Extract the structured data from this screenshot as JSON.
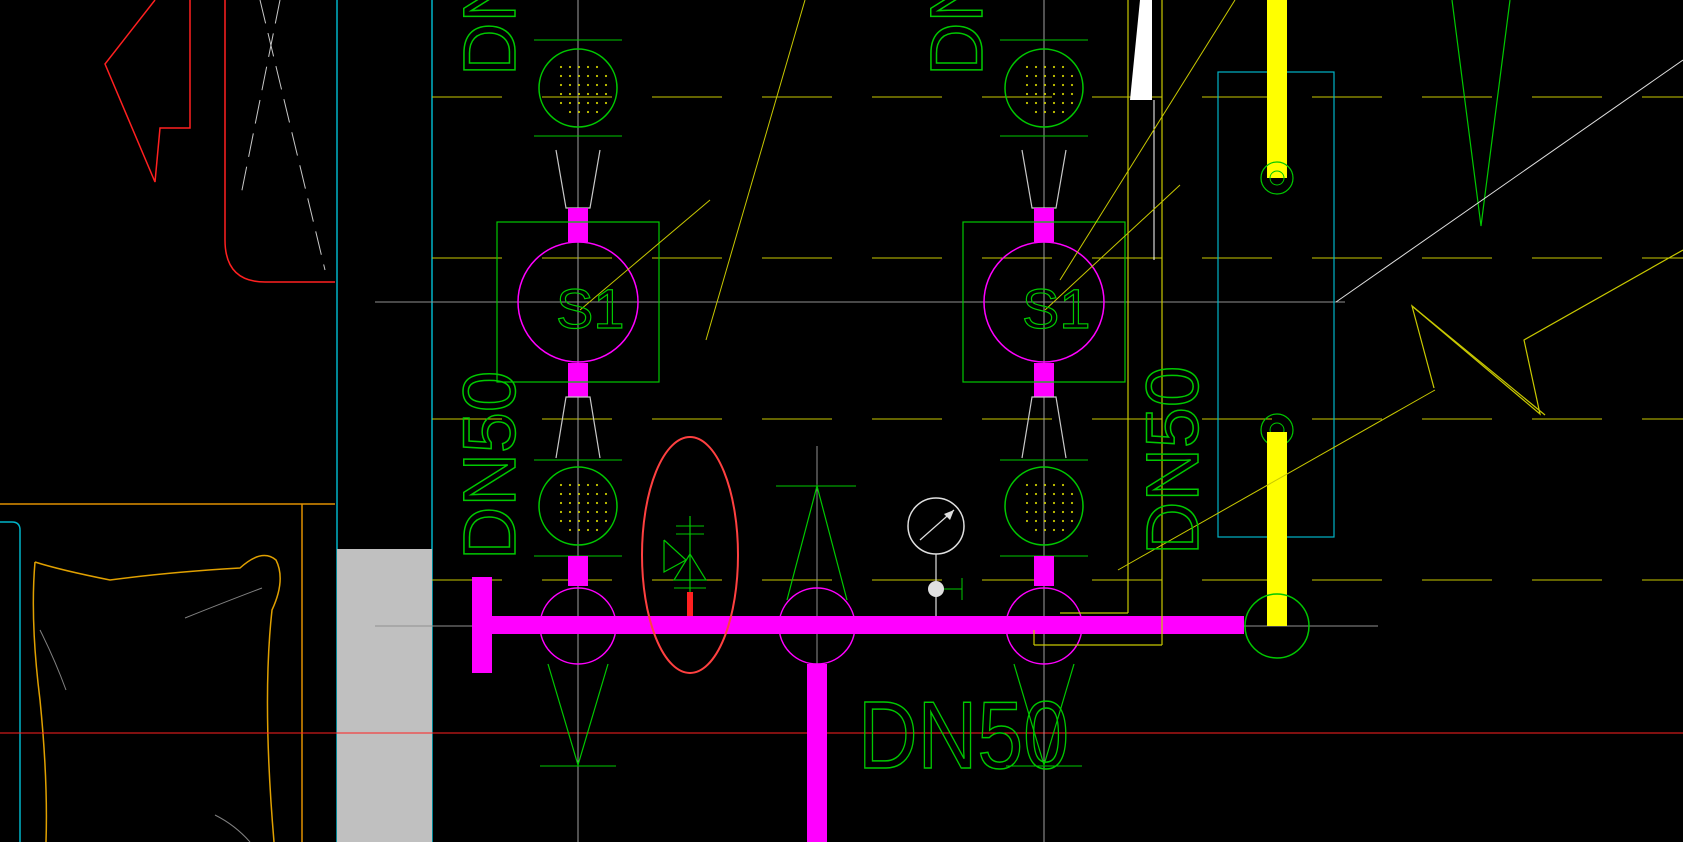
{
  "drawing": {
    "background": "#000000",
    "labels": {
      "pipe_size_bottom": "DN50",
      "pipe_size_left_vertical": "DN50",
      "pipe_size_right_vertical": "DN50",
      "pipe_size_top_left": "DN",
      "pipe_size_top_right": "DN",
      "pump_left_mark": "S1",
      "pump_right_mark": "S1"
    },
    "colors": {
      "main_pipe": "#ff00ff",
      "green_lines": "#00c800",
      "yellow_lines": "#c8c800",
      "cyan_lines": "#00b4c8",
      "red_lines": "#ff2020",
      "highlight_ellipse": "#ff4040",
      "bright_yellow_pipe": "#ffff00",
      "gray_block": "#c0c0c0",
      "orange_lines": "#e09000"
    },
    "icons": {
      "pump_symbol": "centrifugal-pump-icon",
      "check_valve": "check-valve-icon",
      "pressure_gauge": "pressure-gauge-icon",
      "y_strainer": "strainer-icon"
    }
  }
}
